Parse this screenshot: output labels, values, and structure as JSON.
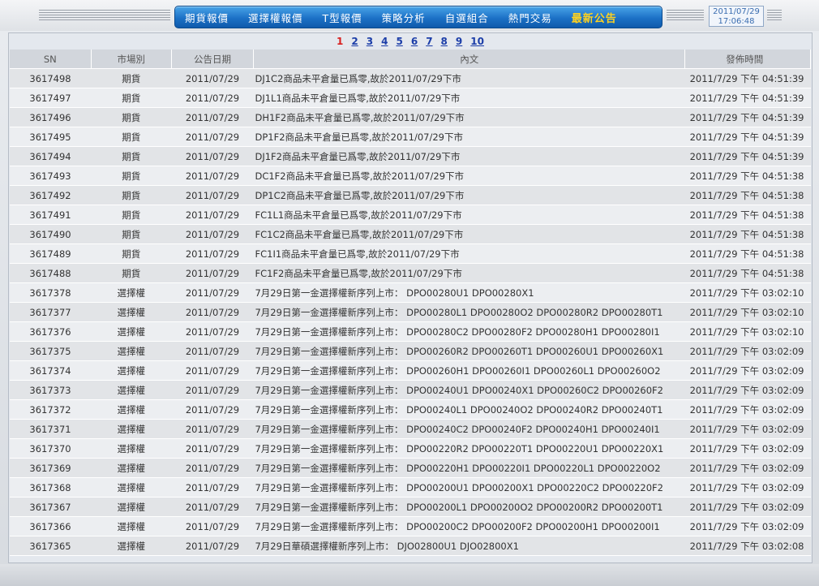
{
  "nav": {
    "items": [
      {
        "label": "期貨報價"
      },
      {
        "label": "選擇權報價"
      },
      {
        "label": "T型報價"
      },
      {
        "label": "策略分析"
      },
      {
        "label": "自選組合"
      },
      {
        "label": "熱門交易"
      },
      {
        "label": "最新公告"
      }
    ],
    "active_index": 6
  },
  "datetime": {
    "date": "2011/07/29",
    "time": "17:06:48"
  },
  "pager": {
    "current": "1",
    "pages": [
      "2",
      "3",
      "4",
      "5",
      "6",
      "7",
      "8",
      "9",
      "10"
    ]
  },
  "table": {
    "headers": {
      "sn": "SN",
      "market": "市場別",
      "date": "公告日期",
      "text": "內文",
      "time": "發佈時間"
    },
    "rows": [
      {
        "sn": "3617498",
        "market": "期貨",
        "date": "2011/07/29",
        "text": "DJ1C2商品未平倉量已爲零,故於2011/07/29下市",
        "time": "2011/7/29 下午 04:51:39"
      },
      {
        "sn": "3617497",
        "market": "期貨",
        "date": "2011/07/29",
        "text": "DJ1L1商品未平倉量已爲零,故於2011/07/29下市",
        "time": "2011/7/29 下午 04:51:39"
      },
      {
        "sn": "3617496",
        "market": "期貨",
        "date": "2011/07/29",
        "text": "DH1F2商品未平倉量已爲零,故於2011/07/29下市",
        "time": "2011/7/29 下午 04:51:39"
      },
      {
        "sn": "3617495",
        "market": "期貨",
        "date": "2011/07/29",
        "text": "DP1F2商品未平倉量已爲零,故於2011/07/29下市",
        "time": "2011/7/29 下午 04:51:39"
      },
      {
        "sn": "3617494",
        "market": "期貨",
        "date": "2011/07/29",
        "text": "DJ1F2商品未平倉量已爲零,故於2011/07/29下市",
        "time": "2011/7/29 下午 04:51:39"
      },
      {
        "sn": "3617493",
        "market": "期貨",
        "date": "2011/07/29",
        "text": "DC1F2商品未平倉量已爲零,故於2011/07/29下市",
        "time": "2011/7/29 下午 04:51:38"
      },
      {
        "sn": "3617492",
        "market": "期貨",
        "date": "2011/07/29",
        "text": "DP1C2商品未平倉量已爲零,故於2011/07/29下市",
        "time": "2011/7/29 下午 04:51:38"
      },
      {
        "sn": "3617491",
        "market": "期貨",
        "date": "2011/07/29",
        "text": "FC1L1商品未平倉量已爲零,故於2011/07/29下市",
        "time": "2011/7/29 下午 04:51:38"
      },
      {
        "sn": "3617490",
        "market": "期貨",
        "date": "2011/07/29",
        "text": "FC1C2商品未平倉量已爲零,故於2011/07/29下市",
        "time": "2011/7/29 下午 04:51:38"
      },
      {
        "sn": "3617489",
        "market": "期貨",
        "date": "2011/07/29",
        "text": "FC1I1商品未平倉量已爲零,故於2011/07/29下市",
        "time": "2011/7/29 下午 04:51:38"
      },
      {
        "sn": "3617488",
        "market": "期貨",
        "date": "2011/07/29",
        "text": "FC1F2商品未平倉量已爲零,故於2011/07/29下市",
        "time": "2011/7/29 下午 04:51:38"
      },
      {
        "sn": "3617378",
        "market": "選擇權",
        "date": "2011/07/29",
        "text": "7月29日第一金選擇權新序列上市： DPO00280U1 DPO00280X1",
        "time": "2011/7/29 下午 03:02:10"
      },
      {
        "sn": "3617377",
        "market": "選擇權",
        "date": "2011/07/29",
        "text": "7月29日第一金選擇權新序列上市： DPO00280L1 DPO00280O2 DPO00280R2 DPO00280T1",
        "time": "2011/7/29 下午 03:02:10"
      },
      {
        "sn": "3617376",
        "market": "選擇權",
        "date": "2011/07/29",
        "text": "7月29日第一金選擇權新序列上市： DPO00280C2 DPO00280F2 DPO00280H1 DPO00280I1",
        "time": "2011/7/29 下午 03:02:10"
      },
      {
        "sn": "3617375",
        "market": "選擇權",
        "date": "2011/07/29",
        "text": "7月29日第一金選擇權新序列上市： DPO00260R2 DPO00260T1 DPO00260U1 DPO00260X1",
        "time": "2011/7/29 下午 03:02:09"
      },
      {
        "sn": "3617374",
        "market": "選擇權",
        "date": "2011/07/29",
        "text": "7月29日第一金選擇權新序列上市： DPO00260H1 DPO00260I1 DPO00260L1 DPO00260O2",
        "time": "2011/7/29 下午 03:02:09"
      },
      {
        "sn": "3617373",
        "market": "選擇權",
        "date": "2011/07/29",
        "text": "7月29日第一金選擇權新序列上市： DPO00240U1 DPO00240X1 DPO00260C2 DPO00260F2",
        "time": "2011/7/29 下午 03:02:09"
      },
      {
        "sn": "3617372",
        "market": "選擇權",
        "date": "2011/07/29",
        "text": "7月29日第一金選擇權新序列上市： DPO00240L1 DPO00240O2 DPO00240R2 DPO00240T1",
        "time": "2011/7/29 下午 03:02:09"
      },
      {
        "sn": "3617371",
        "market": "選擇權",
        "date": "2011/07/29",
        "text": "7月29日第一金選擇權新序列上市： DPO00240C2 DPO00240F2 DPO00240H1 DPO00240I1",
        "time": "2011/7/29 下午 03:02:09"
      },
      {
        "sn": "3617370",
        "market": "選擇權",
        "date": "2011/07/29",
        "text": "7月29日第一金選擇權新序列上市： DPO00220R2 DPO00220T1 DPO00220U1 DPO00220X1",
        "time": "2011/7/29 下午 03:02:09"
      },
      {
        "sn": "3617369",
        "market": "選擇權",
        "date": "2011/07/29",
        "text": "7月29日第一金選擇權新序列上市： DPO00220H1 DPO00220I1 DPO00220L1 DPO00220O2",
        "time": "2011/7/29 下午 03:02:09"
      },
      {
        "sn": "3617368",
        "market": "選擇權",
        "date": "2011/07/29",
        "text": "7月29日第一金選擇權新序列上市： DPO00200U1 DPO00200X1 DPO00220C2 DPO00220F2",
        "time": "2011/7/29 下午 03:02:09"
      },
      {
        "sn": "3617367",
        "market": "選擇權",
        "date": "2011/07/29",
        "text": "7月29日第一金選擇權新序列上市： DPO00200L1 DPO00200O2 DPO00200R2 DPO00200T1",
        "time": "2011/7/29 下午 03:02:09"
      },
      {
        "sn": "3617366",
        "market": "選擇權",
        "date": "2011/07/29",
        "text": "7月29日第一金選擇權新序列上市： DPO00200C2 DPO00200F2 DPO00200H1 DPO00200I1",
        "time": "2011/7/29 下午 03:02:09"
      },
      {
        "sn": "3617365",
        "market": "選擇權",
        "date": "2011/07/29",
        "text": "7月29日華碩選擇權新序列上市： DJO02800U1 DJO02800X1",
        "time": "2011/7/29 下午 03:02:08"
      }
    ]
  }
}
